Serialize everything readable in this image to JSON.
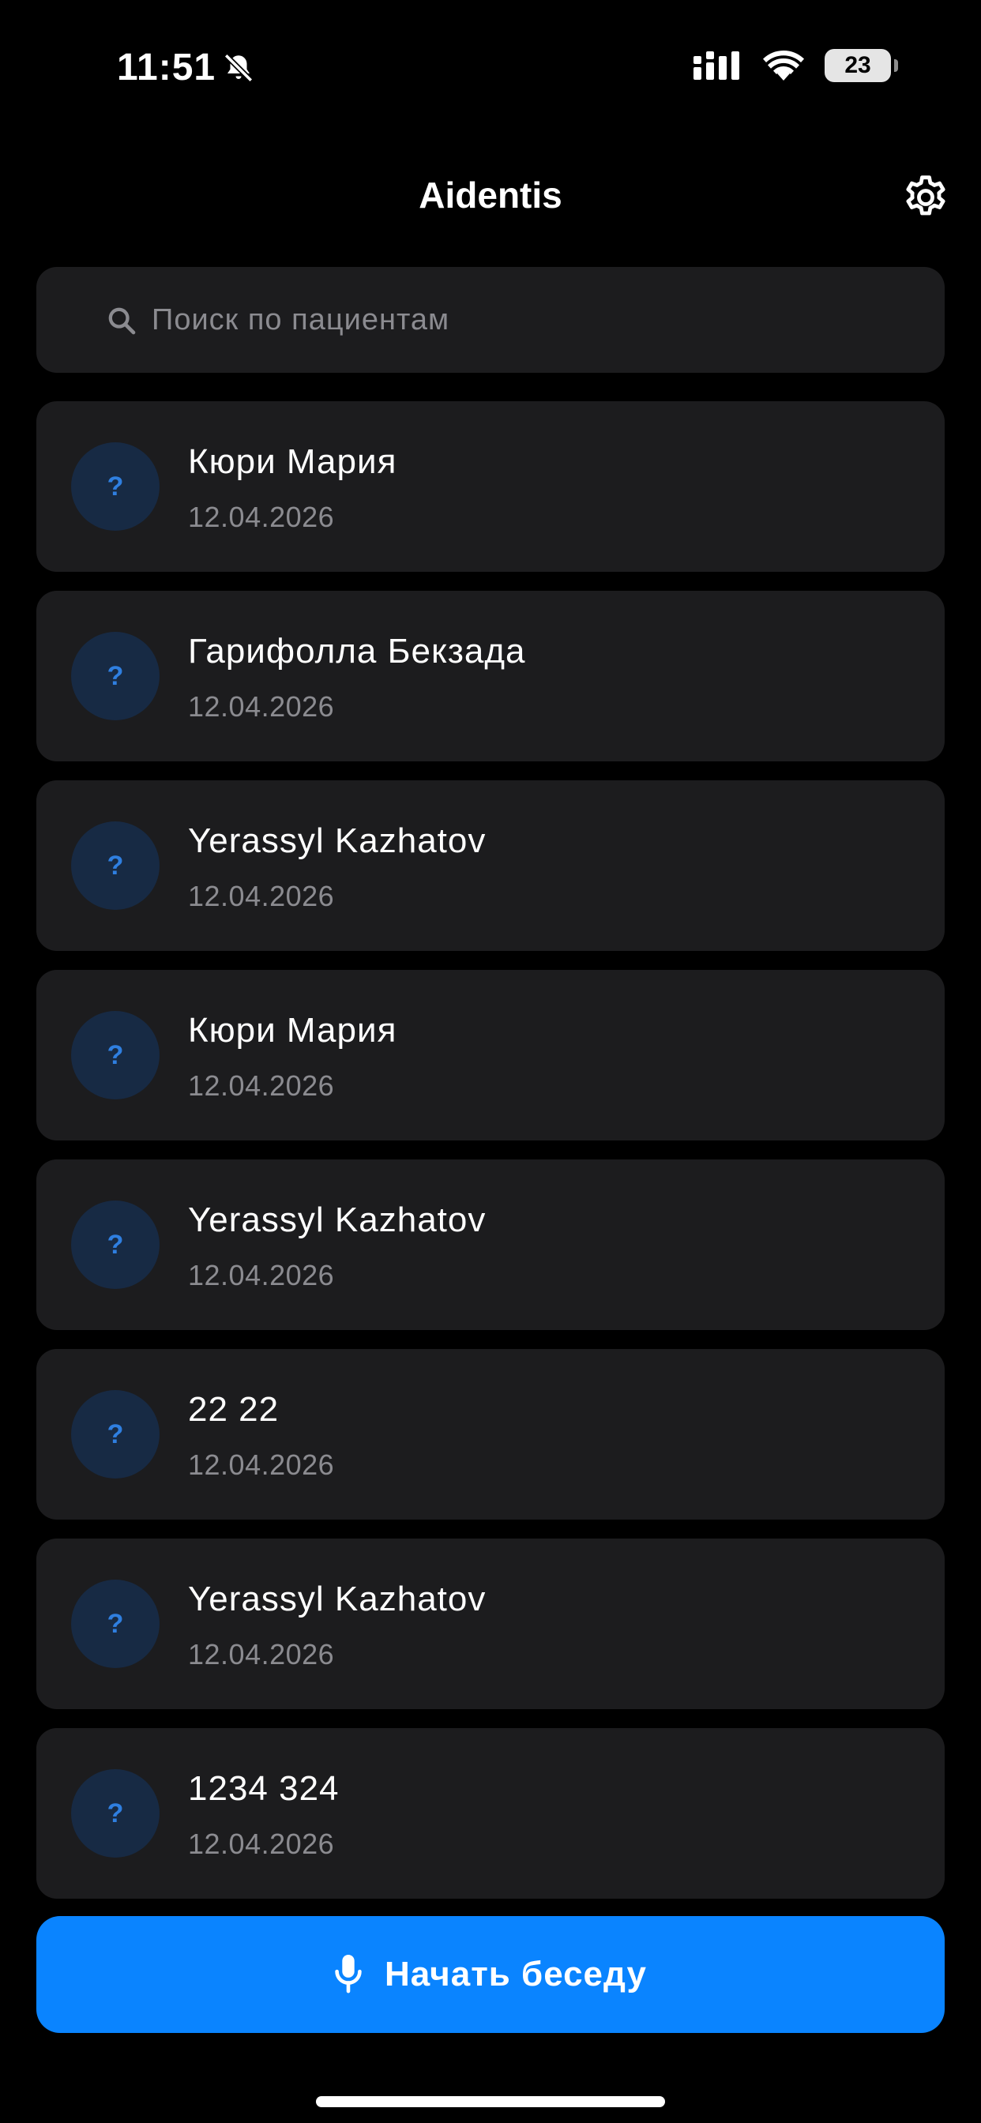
{
  "status_bar": {
    "time": "11:51",
    "battery": "23",
    "icons": [
      "bell-slash-icon",
      "cellular-signal-icon",
      "wifi-icon",
      "battery-icon"
    ]
  },
  "header": {
    "title": "Aidentis",
    "settings_icon": "gear-icon"
  },
  "search": {
    "placeholder": "Поиск по пациентам",
    "value": "",
    "icon": "search-icon"
  },
  "patients": [
    {
      "avatar": "?",
      "name": "Кюри Мария",
      "date": "12.04.2026"
    },
    {
      "avatar": "?",
      "name": "Гарифолла Бекзада",
      "date": "12.04.2026"
    },
    {
      "avatar": "?",
      "name": "Yerassyl Kazhatov",
      "date": "12.04.2026"
    },
    {
      "avatar": "?",
      "name": "Кюри Мария",
      "date": "12.04.2026"
    },
    {
      "avatar": "?",
      "name": "Yerassyl Kazhatov",
      "date": "12.04.2026"
    },
    {
      "avatar": "?",
      "name": "22 22",
      "date": "12.04.2026"
    },
    {
      "avatar": "?",
      "name": "Yerassyl Kazhatov",
      "date": "12.04.2026"
    },
    {
      "avatar": "?",
      "name": "1234 324",
      "date": "12.04.2026"
    }
  ],
  "start_button": {
    "label": "Начать беседу",
    "icon": "microphone-icon"
  },
  "colors": {
    "background": "#000000",
    "card": "#1c1c1e",
    "accent": "#0a84ff",
    "avatar_bg": "#172a44",
    "avatar_fg": "#2f7fe0",
    "secondary_text": "#8b8b90"
  }
}
